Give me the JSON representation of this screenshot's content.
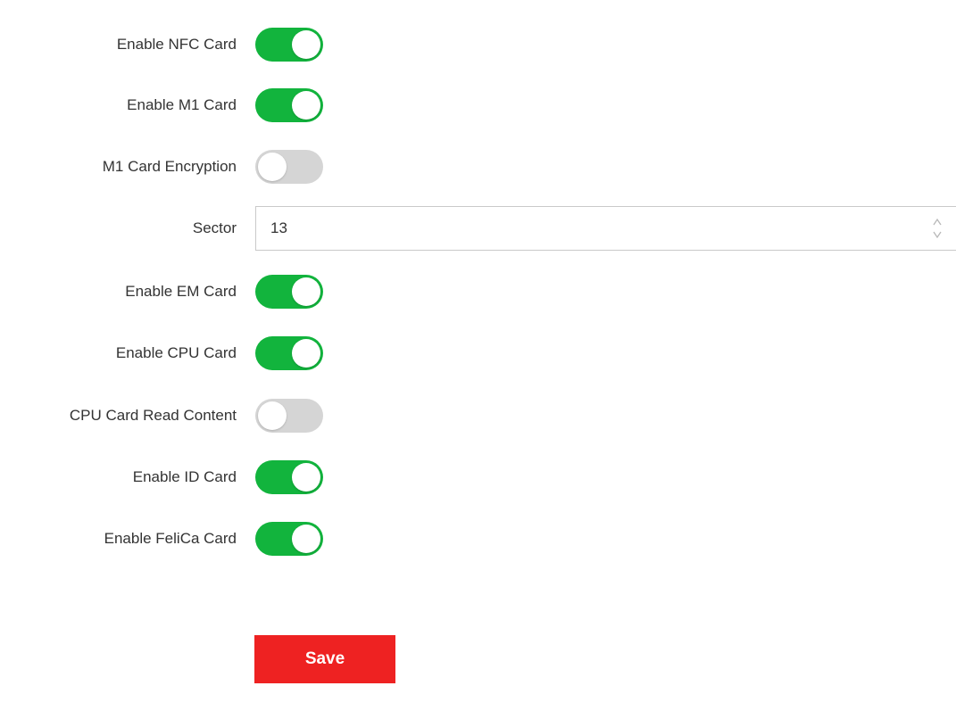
{
  "form": {
    "rows": [
      {
        "label": "Enable NFC Card",
        "state": "on"
      },
      {
        "label": "Enable M1 Card",
        "state": "on"
      },
      {
        "label": "M1 Card Encryption",
        "state": "off"
      },
      {
        "label": "Sector",
        "value": "13"
      },
      {
        "label": "Enable EM Card",
        "state": "on"
      },
      {
        "label": "Enable CPU Card",
        "state": "on"
      },
      {
        "label": "CPU Card Read Content",
        "state": "off"
      },
      {
        "label": "Enable ID Card",
        "state": "on"
      },
      {
        "label": "Enable FeliCa Card",
        "state": "on"
      }
    ],
    "save_label": "Save"
  },
  "colors": {
    "toggle_on": "#12b43d",
    "toggle_off": "#d5d5d5",
    "save_button": "#ee2222"
  },
  "icons": {
    "stepper": "up-down-arrows-icon"
  }
}
